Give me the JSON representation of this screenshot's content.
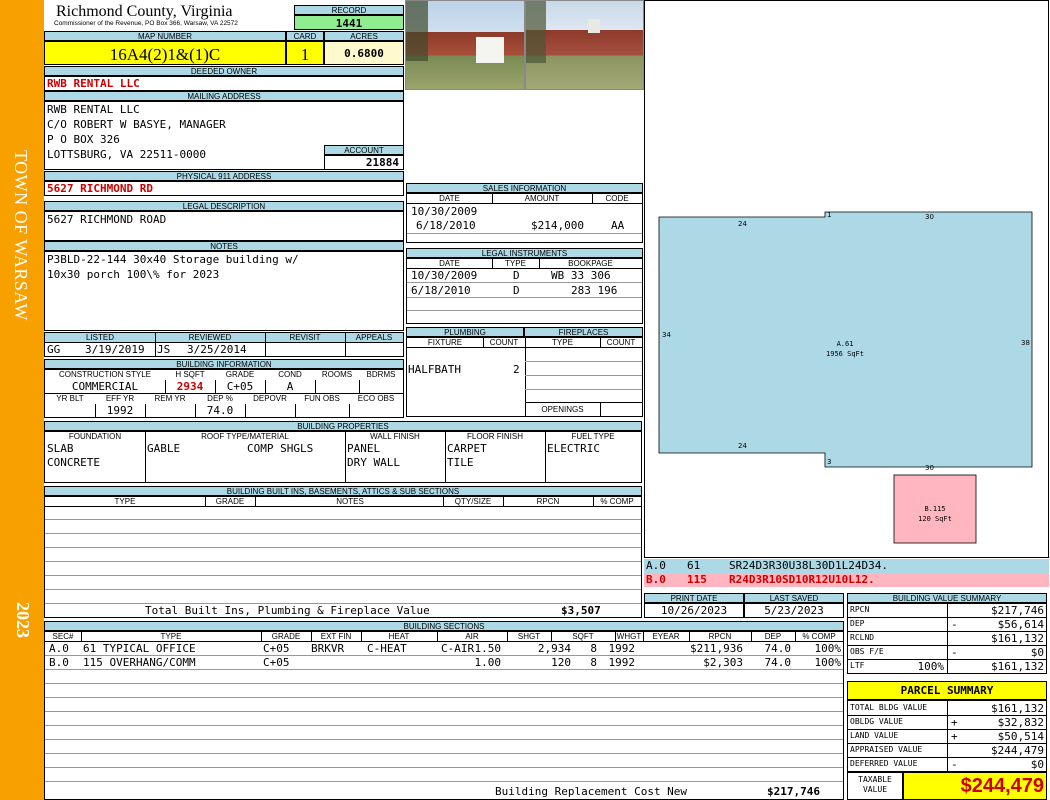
{
  "side": {
    "town": "TOWN OF WARSAW",
    "year": "2023"
  },
  "header": {
    "county": "Richmond County, Virginia",
    "commissioner": "Commissioner of the Revenue, PO Box 366, Warsaw, VA 22572",
    "record_label": "RECORD",
    "record": "1441",
    "map_label": "MAP NUMBER",
    "map_number": "16A4(2)1&(1)C",
    "card_label": "CARD",
    "card": "1",
    "acres_label": "ACRES",
    "acres": "0.6800"
  },
  "owner": {
    "deeded_label": "DEEDED OWNER",
    "deeded": "RWB RENTAL LLC",
    "mailing_label": "MAILING ADDRESS",
    "mailing": [
      "RWB RENTAL LLC",
      "C/O ROBERT W BASYE, MANAGER",
      "P O BOX 326",
      "LOTTSBURG, VA 22511-0000"
    ],
    "account_label": "ACCOUNT",
    "account": "21884",
    "physical_label": "PHYSICAL 911 ADDRESS",
    "physical": "5627 RICHMOND RD",
    "legal_label": "LEGAL DESCRIPTION",
    "legal": "5627 RICHMOND ROAD",
    "notes_label": "NOTES",
    "notes": [
      "P3BLD-22-144 30x40 Storage building w/",
      "10x30 porch 100\\% for 2023"
    ]
  },
  "sales": {
    "title": "SALES INFORMATION",
    "cols": [
      "DATE",
      "AMOUNT",
      "CODE"
    ],
    "rows": [
      {
        "date": "10/30/2009",
        "amount": "",
        "code": ""
      },
      {
        "date": "6/18/2010",
        "amount": "$214,000",
        "code": "AA"
      }
    ]
  },
  "legal_instruments": {
    "title": "LEGAL INSTRUMENTS",
    "cols": [
      "DATE",
      "TYPE",
      "BOOKPAGE"
    ],
    "rows": [
      {
        "date": "10/30/2009",
        "type": "D",
        "book": "WB 33 306"
      },
      {
        "date": "6/18/2010",
        "type": "D",
        "book": "283 196"
      }
    ]
  },
  "review": {
    "cols": [
      "LISTED",
      "REVIEWED",
      "REVISIT",
      "APPEALS"
    ],
    "listed_by": "GG",
    "listed": "3/19/2019",
    "reviewed_by": "JS",
    "reviewed": "3/25/2014"
  },
  "building_info": {
    "title": "BUILDING INFORMATION",
    "cols1": [
      "CONSTRUCTION STYLE",
      "H SQFT",
      "GRADE",
      "COND",
      "ROOMS",
      "BDRMS"
    ],
    "style": "COMMERCIAL",
    "hsqft": "2934",
    "grade": "C+05",
    "cond": "A",
    "cols2": [
      "YR BLT",
      "EFF YR",
      "REM YR",
      "DEP %",
      "DEPOVR",
      "FUN OBS",
      "ECO OBS"
    ],
    "eff_yr": "1992",
    "dep": "74.0"
  },
  "plumbing": {
    "title": "PLUMBING",
    "cols": [
      "FIXTURE",
      "COUNT"
    ],
    "fixture": "HALFBATH",
    "count": "2"
  },
  "fireplaces": {
    "title": "FIREPLACES",
    "cols": [
      "TYPE",
      "COUNT"
    ],
    "openings": "OPENINGS"
  },
  "properties": {
    "title": "BUILDING PROPERTIES",
    "cols": [
      "FOUNDATION",
      "ROOF TYPE/MATERIAL",
      "WALL FINISH",
      "FLOOR FINISH",
      "FUEL TYPE"
    ],
    "foundation": [
      "SLAB",
      "CONCRETE"
    ],
    "roof_type": "GABLE",
    "roof_mat": "COMP SHGLS",
    "wall": [
      "PANEL",
      "DRY WALL"
    ],
    "floor": [
      "CARPET",
      "TILE"
    ],
    "fuel": "ELECTRIC"
  },
  "builtins": {
    "title": "BUILDING BUILT INS, BASEMENTS, ATTICS & SUB SECTIONS",
    "cols": [
      "TYPE",
      "GRADE",
      "NOTES",
      "QTY/SIZE",
      "RPCN",
      "% COMP"
    ],
    "total_label": "Total Built Ins, Plumbing & Fireplace Value",
    "total": "$3,507"
  },
  "sketch": {
    "a_label": "A.61",
    "a_sqft": "1956 SqFt",
    "b_label": "B.115",
    "b_sqft": "120 SqFt",
    "dims": {
      "top": "30",
      "left_top": "24",
      "left": "34",
      "right": "38",
      "left_bottom": "24",
      "bottom": "30",
      "c1": "1",
      "c3": "3"
    },
    "legend": [
      {
        "code": "A.0",
        "num": "61",
        "path": "SR24D3R30U38L30D1L24D34."
      },
      {
        "code": "B.0",
        "num": "115",
        "path": "R24D3R10SD10R12U10L12."
      }
    ],
    "colors": {
      "a": "#add8e6",
      "b": "#ffb6c1"
    }
  },
  "dates": {
    "print_label": "PRINT DATE",
    "print": "10/26/2023",
    "saved_label": "LAST SAVED",
    "saved": "5/23/2023"
  },
  "sections": {
    "title": "BUILDING SECTIONS",
    "cols": [
      "SEC#",
      "TYPE",
      "GRADE",
      "EXT FIN",
      "HEAT",
      "AIR",
      "SHGT",
      "SQFT",
      "WHGT",
      "EYEAR",
      "RPCN",
      "DEP",
      "% COMP"
    ],
    "rows": [
      {
        "sec": "A.0",
        "type": "61 TYPICAL OFFICE",
        "grade": "C+05",
        "ext": "BRKVR",
        "heat": "C-HEAT",
        "air": "C-AIR",
        "shgt": "1.50",
        "sqft": "2,934",
        "whgt": "8",
        "eyear": "1992",
        "rpcn": "$211,936",
        "dep": "74.0",
        "comp": "100%"
      },
      {
        "sec": "B.0",
        "type": "115 OVERHANG/COMM",
        "grade": "C+05",
        "ext": "",
        "heat": "",
        "air": "",
        "shgt": "1.00",
        "sqft": "120",
        "whgt": "8",
        "eyear": "1992",
        "rpcn": "$2,303",
        "dep": "74.0",
        "comp": "100%"
      }
    ],
    "replacement_label": "Building Replacement Cost New",
    "replacement": "$217,746"
  },
  "value_summary": {
    "title": "BUILDING VALUE SUMMARY",
    "rows": [
      {
        "label": "RPCN",
        "extra": "",
        "sign": "",
        "value": "$217,746"
      },
      {
        "label": "DEP",
        "extra": "",
        "sign": "-",
        "value": "$56,614"
      },
      {
        "label": "RCLND",
        "extra": "",
        "sign": "",
        "value": "$161,132"
      },
      {
        "label": "OBS F/E",
        "extra": "",
        "sign": "-",
        "value": "$0"
      },
      {
        "label": "LTF",
        "extra": "100%",
        "sign": "",
        "value": "$161,132"
      }
    ]
  },
  "parcel": {
    "title": "PARCEL SUMMARY",
    "rows": [
      {
        "label": "TOTAL BLDG VALUE",
        "sign": "",
        "value": "$161,132"
      },
      {
        "label": "OBLDG VALUE",
        "sign": "+",
        "value": "$32,832"
      },
      {
        "label": "LAND VALUE",
        "sign": "+",
        "value": "$50,514"
      },
      {
        "label": "APPRAISED VALUE",
        "sign": "",
        "value": "$244,479"
      },
      {
        "label": "DEFERRED VALUE",
        "sign": "-",
        "value": "$0"
      }
    ],
    "taxable_label": "TAXABLE VALUE",
    "taxable": "$244,479"
  }
}
